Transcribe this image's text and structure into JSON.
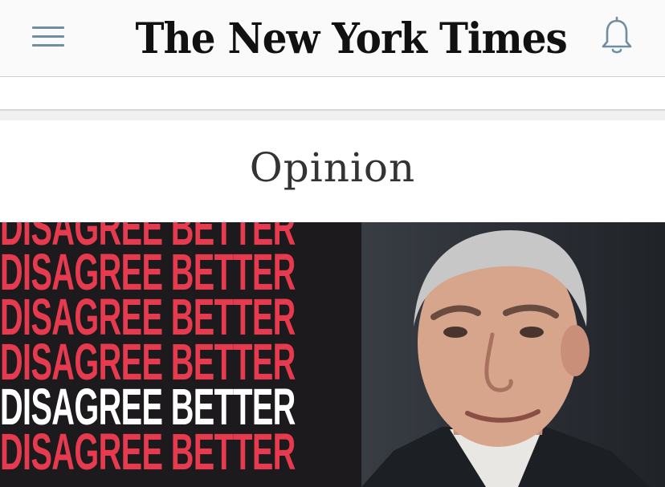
{
  "header": {
    "logo_text": "The New York Times",
    "menu_icon": "hamburger-menu-icon",
    "bell_icon": "bell-icon"
  },
  "section": {
    "title": "Opinion"
  },
  "hero": {
    "lines": [
      "DISAGREE BETTER",
      "DISAGREE BETTER",
      "DISAGREE BETTER",
      "DISAGREE BETTER",
      "DISAGREE BETTER",
      "DISAGREE BETTER"
    ],
    "highlight_line_index": 4,
    "colors": {
      "text": "#e63a4e",
      "highlight_text": "#ffffff",
      "background": "#1c1a1c"
    }
  },
  "colors": {
    "header_bg": "#fafafa",
    "icon_color": "#6f8da3",
    "section_title": "#333333"
  }
}
